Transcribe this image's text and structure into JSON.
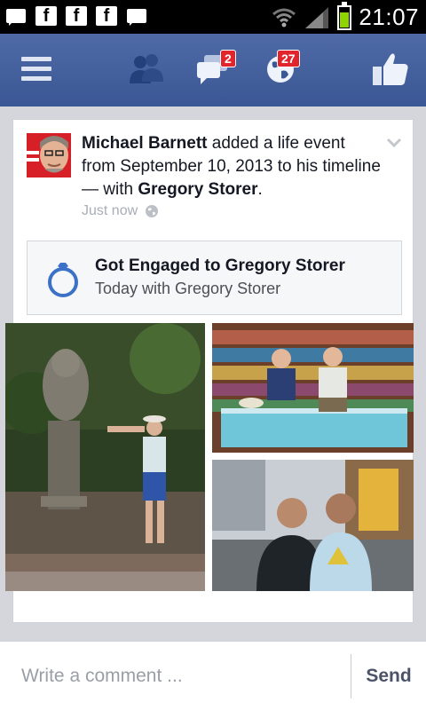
{
  "status_bar": {
    "time": "21:07",
    "left_icons": [
      "message-icon",
      "facebook-icon",
      "facebook-icon",
      "facebook-icon",
      "message-icon"
    ],
    "right_icons": [
      "wifi-icon",
      "signal-icon",
      "battery-icon"
    ]
  },
  "header": {
    "messages_badge": "2",
    "notifications_badge": "27",
    "colors": {
      "bar": "#3b5998",
      "badge": "#e0262c"
    }
  },
  "post": {
    "author": "Michael Barnett",
    "action_text": " added a life event from September 10, 2013 to his timeline — with ",
    "tagged": "Gregory Storer",
    "end": ".",
    "timestamp": "Just now",
    "privacy_icon": "globe-icon"
  },
  "life_event": {
    "icon": "ring-icon",
    "title": "Got Engaged to Gregory Storer",
    "subtitle": "Today with Gregory Storer"
  },
  "photos": [
    "photo-statue-garden",
    "photo-bookstore-fish-spa",
    "photo-street-selfie"
  ],
  "comment": {
    "placeholder": "Write a comment ...",
    "send_label": "Send"
  }
}
